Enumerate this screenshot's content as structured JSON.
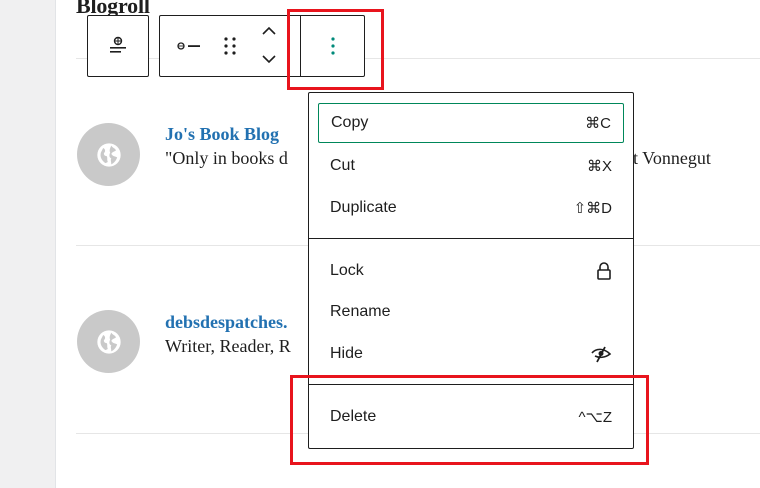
{
  "page": {
    "heading": "Blogroll"
  },
  "blogs": [
    {
      "title": "Jo's Book Blog",
      "description_start": "\"Only in books d",
      "description_end": "t Vonnegut"
    },
    {
      "title": "debsdespatches.",
      "description": "Writer, Reader, R"
    }
  ],
  "toolbar": {
    "transform_icon": "globe-with-lines-icon",
    "drag_icon": "drag-handle-icon",
    "move_up_icon": "chevron-up-icon",
    "move_down_icon": "chevron-down-icon",
    "options_icon": "more-vertical-icon"
  },
  "options_menu": {
    "items": [
      {
        "label": "Copy",
        "shortcut": "⌘C"
      },
      {
        "label": "Cut",
        "shortcut": "⌘X"
      },
      {
        "label": "Duplicate",
        "shortcut": "⇧⌘D"
      },
      {
        "label": "Lock",
        "icon": "lock-icon"
      },
      {
        "label": "Rename"
      },
      {
        "label": "Hide",
        "icon": "hidden-eye-icon"
      },
      {
        "label": "Delete",
        "shortcut": "^⌥Z"
      }
    ]
  },
  "colors": {
    "link": "#2271b1",
    "focus": "#00875a",
    "annotation": "#e8141d",
    "options_icon": "#008a7a"
  }
}
